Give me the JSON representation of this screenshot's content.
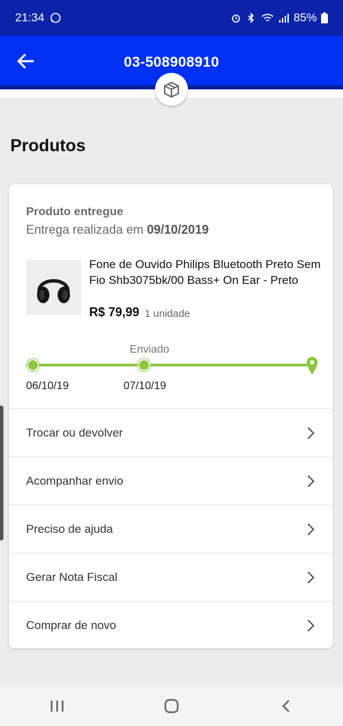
{
  "status_bar": {
    "time": "21:34",
    "battery": "85%"
  },
  "app_bar": {
    "order_number": "03-508908910",
    "back_icon": "arrow-left-icon",
    "badge_icon": "package-box-icon"
  },
  "section": {
    "title": "Produtos"
  },
  "order": {
    "status_title": "Produto entregue",
    "delivery_text": "Entrega realizada em",
    "delivery_date": "09/10/2019",
    "product": {
      "name": "Fone de Ouvido Philips Bluetooth Preto Sem Fio Shb3075bk/00 Bass+ On Ear - Preto",
      "price": "R$ 79,99",
      "quantity": "1 unidade"
    },
    "timeline": {
      "current_label": "Enviado",
      "dates": [
        "06/10/19",
        "07/10/19"
      ],
      "progress": 1.0
    },
    "actions": [
      {
        "label": "Trocar ou devolver"
      },
      {
        "label": "Acompanhar envio"
      },
      {
        "label": "Preciso de ajuda"
      },
      {
        "label": "Gerar Nota Fiscal"
      },
      {
        "label": "Comprar de novo"
      }
    ]
  },
  "colors": {
    "primary_blue": "#0031f2",
    "status_blue": "#0a23a8",
    "timeline_green": "#8ec63f"
  }
}
